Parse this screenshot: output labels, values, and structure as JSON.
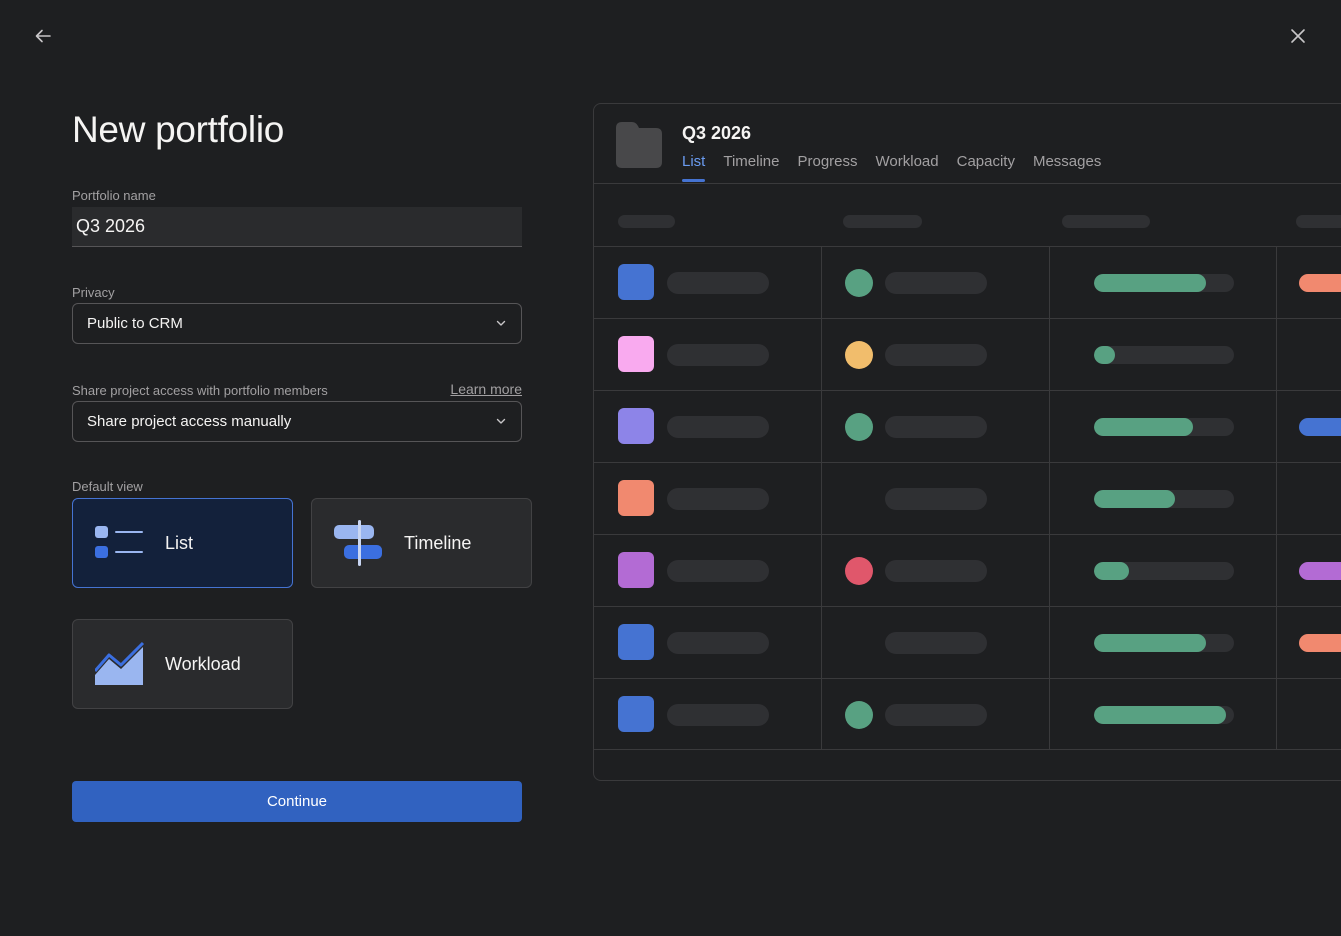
{
  "form": {
    "title": "New portfolio",
    "name_label": "Portfolio name",
    "name_value": "Q3 2026",
    "privacy_label": "Privacy",
    "privacy_value": "Public to CRM",
    "share_label": "Share project access with portfolio members",
    "learn_more": "Learn more",
    "share_value": "Share project access manually",
    "default_view_label": "Default view",
    "views": [
      {
        "label": "List",
        "icon": "list-view-icon",
        "selected": true
      },
      {
        "label": "Timeline",
        "icon": "timeline-view-icon",
        "selected": false
      },
      {
        "label": "Workload",
        "icon": "workload-view-icon",
        "selected": false
      }
    ],
    "continue_label": "Continue"
  },
  "preview": {
    "title": "Q3 2026",
    "tabs": [
      "List",
      "Timeline",
      "Progress",
      "Workload",
      "Capacity",
      "Messages"
    ],
    "active_tab": "List",
    "rows": [
      {
        "color": "#4573d2",
        "status": "#58a182",
        "progress": 0.8,
        "tag": "#f1896f"
      },
      {
        "color": "#f9aaef",
        "status": "#f1bd6c",
        "progress": 0.15,
        "tag": null
      },
      {
        "color": "#8d84e8",
        "status": "#58a182",
        "progress": 0.71,
        "tag": "#4573d2"
      },
      {
        "color": "#f1896f",
        "status": null,
        "progress": 0.58,
        "tag": null
      },
      {
        "color": "#b36bd4",
        "status": "#e0576b",
        "progress": 0.25,
        "tag": "#b36bd4"
      },
      {
        "color": "#4573d2",
        "status": null,
        "progress": 0.8,
        "tag": "#f1896f"
      },
      {
        "color": "#4573d2",
        "status": "#58a182",
        "progress": 0.94,
        "tag": null
      }
    ]
  },
  "colors": {
    "accent": "#3162c0",
    "background": "#1e1f21"
  }
}
